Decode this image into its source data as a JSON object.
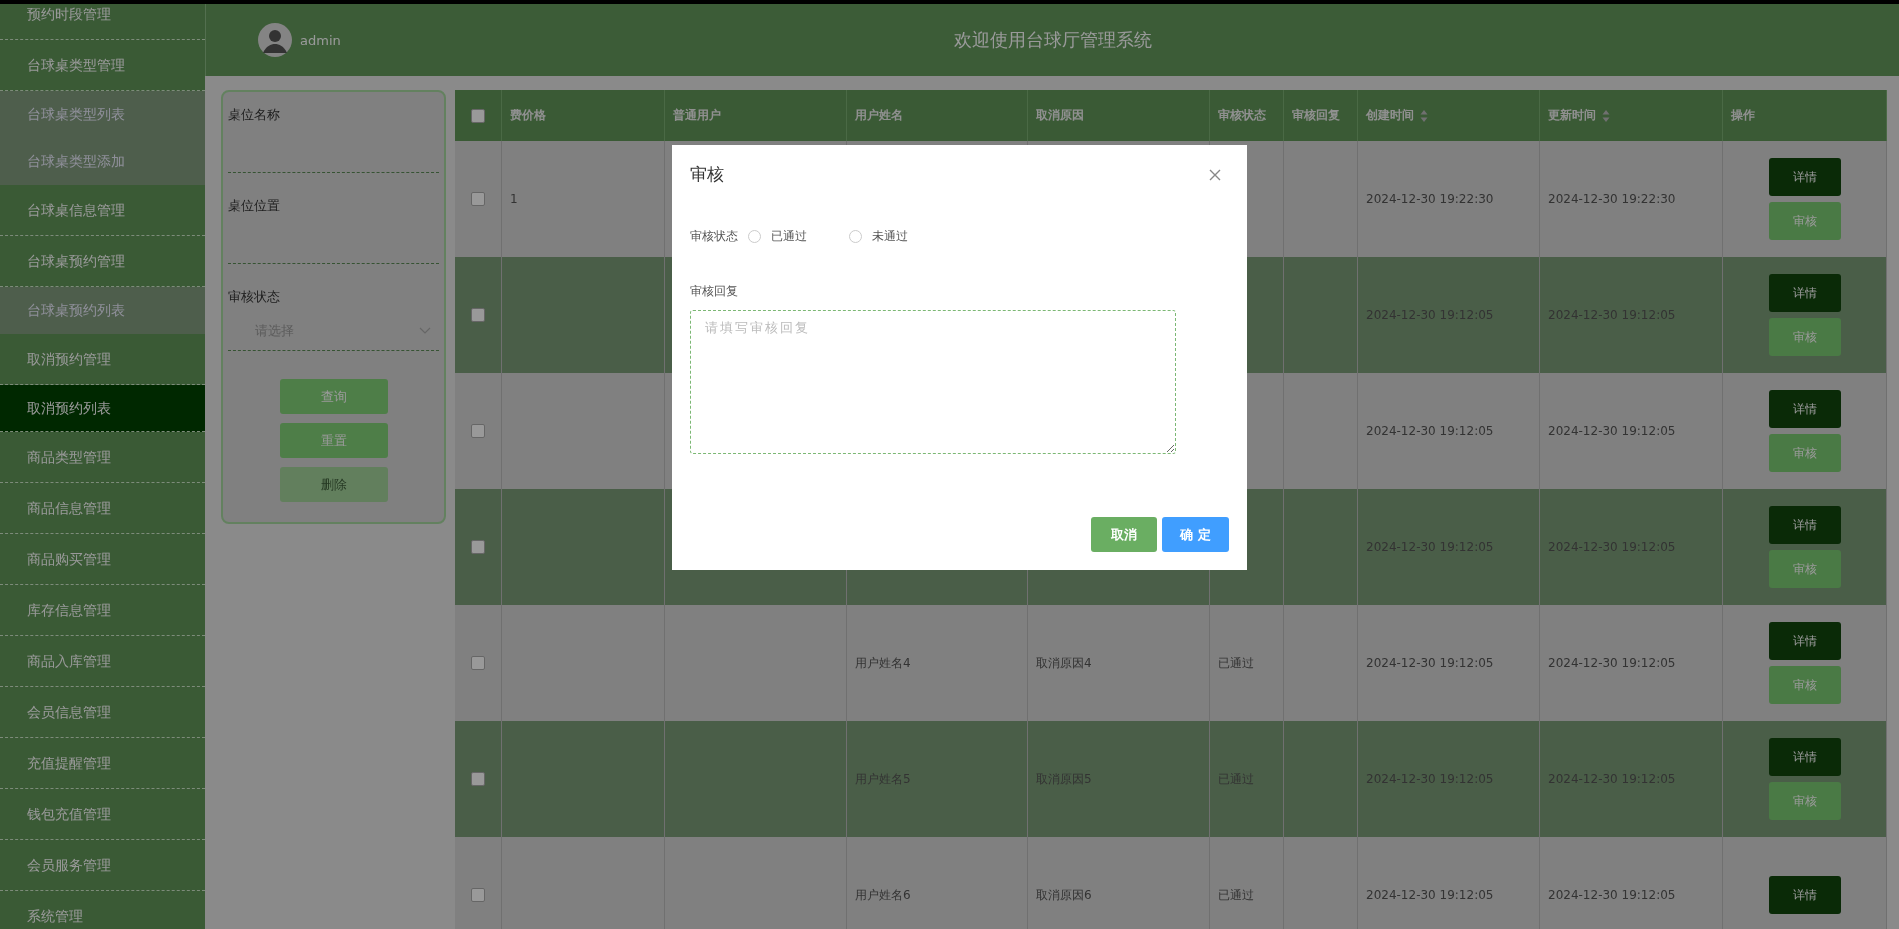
{
  "sidebar": {
    "items": [
      {
        "label": "预约时段管理",
        "selected": false
      },
      {
        "label": "台球桌类型管理",
        "selected": false,
        "children": [
          {
            "label": "台球桌类型列表",
            "selected": false
          },
          {
            "label": "台球桌类型添加",
            "selected": false
          }
        ]
      },
      {
        "label": "台球桌信息管理",
        "selected": false
      },
      {
        "label": "台球桌预约管理",
        "selected": false,
        "children": [
          {
            "label": "台球桌预约列表",
            "selected": false
          }
        ]
      },
      {
        "label": "取消预约管理",
        "selected": false,
        "children": [
          {
            "label": "取消预约列表",
            "selected": true
          }
        ]
      },
      {
        "label": "商品类型管理",
        "selected": false
      },
      {
        "label": "商品信息管理",
        "selected": false
      },
      {
        "label": "商品购买管理",
        "selected": false
      },
      {
        "label": "库存信息管理",
        "selected": false
      },
      {
        "label": "商品入库管理",
        "selected": false
      },
      {
        "label": "会员信息管理",
        "selected": false
      },
      {
        "label": "充值提醒管理",
        "selected": false
      },
      {
        "label": "钱包充值管理",
        "selected": false
      },
      {
        "label": "会员服务管理",
        "selected": false
      },
      {
        "label": "系统管理",
        "selected": false
      }
    ]
  },
  "header": {
    "user": "admin",
    "title": "欢迎使用台球厅管理系统"
  },
  "filter": {
    "fields": [
      {
        "kind": "input",
        "label": "桌位名称"
      },
      {
        "kind": "input",
        "label": "桌位位置"
      },
      {
        "kind": "select",
        "label": "审核状态",
        "placeholder": "请选择"
      }
    ],
    "buttons": [
      {
        "label": "查询",
        "disabled": false
      },
      {
        "label": "重置",
        "disabled": false
      },
      {
        "label": "删除",
        "disabled": true
      }
    ]
  },
  "table": {
    "select_all_checked": false,
    "columns": [
      {
        "kind": "text",
        "label": "费价格",
        "sortable": false
      },
      {
        "kind": "text",
        "label": "普通用户",
        "sortable": false
      },
      {
        "kind": "text",
        "label": "用户姓名",
        "sortable": false
      },
      {
        "kind": "text",
        "label": "取消原因",
        "sortable": false
      },
      {
        "kind": "text",
        "label": "审核状态",
        "sortable": false
      },
      {
        "kind": "text",
        "label": "审核回复",
        "sortable": false
      },
      {
        "kind": "text",
        "label": "创建时间",
        "sortable": true
      },
      {
        "kind": "text",
        "label": "更新时间",
        "sortable": true
      },
      {
        "kind": "actions",
        "label": "操作",
        "sortable": false
      }
    ],
    "rows": [
      {
        "checked": false,
        "cells": [
          "1",
          null,
          null,
          null,
          null,
          null,
          "2024-12-30 19:22:30",
          "2024-12-30 19:22:30"
        ],
        "actions": [
          "详情",
          "审核"
        ]
      },
      {
        "checked": false,
        "cells": [
          null,
          null,
          null,
          null,
          null,
          null,
          "2024-12-30 19:12:05",
          "2024-12-30 19:12:05"
        ],
        "actions": [
          "详情",
          "审核"
        ]
      },
      {
        "checked": false,
        "cells": [
          null,
          null,
          null,
          null,
          null,
          null,
          "2024-12-30 19:12:05",
          "2024-12-30 19:12:05"
        ],
        "actions": [
          "详情",
          "审核"
        ]
      },
      {
        "checked": false,
        "cells": [
          null,
          null,
          null,
          null,
          null,
          null,
          "2024-12-30 19:12:05",
          "2024-12-30 19:12:05"
        ],
        "actions": [
          "详情",
          "审核"
        ]
      },
      {
        "checked": false,
        "cells": [
          null,
          null,
          "用户姓名4",
          "取消原因4",
          "已通过",
          null,
          "2024-12-30 19:12:05",
          "2024-12-30 19:12:05"
        ],
        "actions": [
          "详情",
          "审核"
        ]
      },
      {
        "checked": false,
        "cells": [
          null,
          null,
          "用户姓名5",
          "取消原因5",
          "已通过",
          null,
          "2024-12-30 19:12:05",
          "2024-12-30 19:12:05"
        ],
        "actions": [
          "详情",
          "审核"
        ]
      },
      {
        "checked": false,
        "cells": [
          null,
          null,
          "用户姓名6",
          "取消原因6",
          "已通过",
          null,
          "2024-12-30 19:12:05",
          "2024-12-30 19:12:05"
        ],
        "actions": [
          "详情"
        ]
      }
    ]
  },
  "dialog": {
    "title": "审核",
    "status_label": "审核状态",
    "options": [
      {
        "label": "已通过",
        "selected": false
      },
      {
        "label": "未通过",
        "selected": false
      }
    ],
    "reply_label": "审核回复",
    "reply_placeholder": "请填写审核回复",
    "buttons": [
      {
        "kind": "cancel",
        "label": "取消"
      },
      {
        "kind": "confirm",
        "label": "确 定"
      }
    ]
  }
}
